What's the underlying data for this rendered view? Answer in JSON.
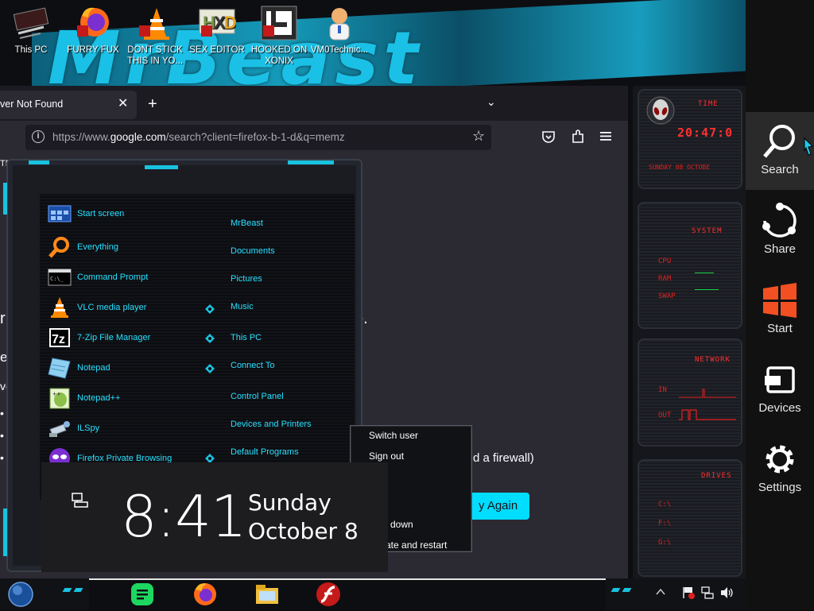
{
  "desktop": {
    "wallpaper_text": "MrBeast",
    "icons": [
      {
        "label": "This PC",
        "icon": "this-pc-icon"
      },
      {
        "label": "FURRY FUX",
        "icon": "firefox-icon"
      },
      {
        "label": "DONT STICK THIS IN YO...",
        "icon": "vlc-cone-icon"
      },
      {
        "label": "SEX EDITOR",
        "icon": "hex-editor-icon"
      },
      {
        "label": "HOOKED ON XONIX",
        "icon": "xonix-game-icon"
      },
      {
        "label": "VM0Technic...",
        "icon": "doctor-icon"
      }
    ]
  },
  "browser": {
    "tab_title": "ver Not Found",
    "url_prefix": "https://www.",
    "url_domain": "google.com",
    "url_rest": "/search?client=firefox-b-1-d&q=memz",
    "step_label": "TEP",
    "page_fragments": [
      "r",
      "e",
      "vo",
      "•",
      "•",
      "•",
      "e."
    ],
    "firewall_text": "d a firewall)",
    "try_again": "y Again"
  },
  "start_menu": {
    "programs": [
      {
        "label": "Start screen",
        "icon": "start-screen-icon"
      },
      {
        "label": "Everything",
        "icon": "magnifier-icon"
      },
      {
        "label": "Command Prompt",
        "icon": "cmd-icon"
      },
      {
        "label": "VLC media player",
        "icon": "vlc-icon"
      },
      {
        "label": "7-Zip File Manager",
        "icon": "7zip-icon"
      },
      {
        "label": "Notepad",
        "icon": "notepad-icon"
      },
      {
        "label": "Notepad++",
        "icon": "notepadpp-icon"
      },
      {
        "label": "ILSpy",
        "icon": "ilspy-icon"
      },
      {
        "label": "Firefox Private Browsing",
        "icon": "private-browsing-icon"
      }
    ],
    "places": [
      {
        "label": "MrBeast",
        "arrow": false
      },
      {
        "label": "Documents",
        "arrow": false
      },
      {
        "label": "Pictures",
        "arrow": false
      },
      {
        "label": "Music",
        "arrow": true
      },
      {
        "label": "This PC",
        "arrow": true
      },
      {
        "label": "Connect To",
        "arrow": true
      },
      {
        "label": "Control Panel",
        "arrow": false
      },
      {
        "label": "Devices and Printers",
        "arrow": false
      },
      {
        "label": "Default Programs",
        "arrow": true
      }
    ]
  },
  "power_menu": {
    "items": [
      "Switch user",
      "Sign out",
      "down",
      "ate and restart"
    ]
  },
  "lock_clock": {
    "time": "8:41",
    "day": "Sunday",
    "date": "October 8"
  },
  "gadgets": {
    "time_title": "TIME",
    "time_value": "20:47:0",
    "date_value": "SUNDAY 08 OCTOBE",
    "system_title": "SYSTEM",
    "system_rows": [
      "CPU",
      "RAM",
      "SWAP"
    ],
    "network_title": "NETWORK",
    "network_rows": [
      "IN",
      "OUT"
    ],
    "drives_title": "DRIVES",
    "drive_rows": [
      "C:\\",
      "F:\\",
      "G:\\"
    ]
  },
  "charms": [
    {
      "label": "Search",
      "icon": "search-icon"
    },
    {
      "label": "Share",
      "icon": "share-icon"
    },
    {
      "label": "Start",
      "icon": "windows-logo-icon"
    },
    {
      "label": "Devices",
      "icon": "devices-icon"
    },
    {
      "label": "Settings",
      "icon": "gear-icon"
    }
  ],
  "taskbar": {
    "items": [
      "start-orb-icon",
      "notes-app-icon",
      "firefox-icon",
      "file-explorer-icon",
      "flash-player-icon"
    ],
    "tray": [
      "flag-icon",
      "network-icon",
      "volume-icon"
    ]
  },
  "colors": {
    "accent_cyan": "#19c2e0",
    "menu_text": "#27e0ff",
    "gadget_red": "#e02020",
    "try_again_button": "#00ddff"
  }
}
